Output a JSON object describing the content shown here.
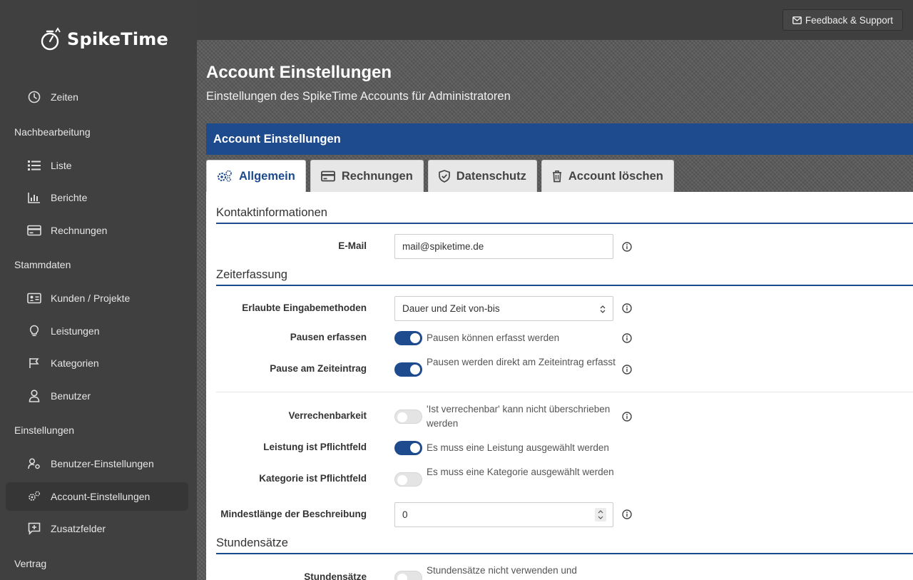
{
  "app": {
    "name": "SpikeTime"
  },
  "topbar": {
    "feedback_label": "Feedback & Support"
  },
  "sidebar": {
    "items": [
      {
        "label": "Zeiten",
        "icon": "clock-icon"
      },
      {
        "heading": "Nachbearbeitung"
      },
      {
        "label": "Liste",
        "icon": "list-icon"
      },
      {
        "label": "Berichte",
        "icon": "chart-icon"
      },
      {
        "label": "Rechnungen",
        "icon": "credit-card-icon"
      },
      {
        "heading": "Stammdaten"
      },
      {
        "label": "Kunden / Projekte",
        "icon": "address-card-icon"
      },
      {
        "label": "Leistungen",
        "icon": "lightbulb-icon"
      },
      {
        "label": "Kategorien",
        "icon": "flag-icon"
      },
      {
        "label": "Benutzer",
        "icon": "user-icon"
      },
      {
        "heading": "Einstellungen"
      },
      {
        "label": "Benutzer-Einstellungen",
        "icon": "user-cog-icon"
      },
      {
        "label": "Account-Einstellungen",
        "icon": "cogs-icon",
        "active": true
      },
      {
        "label": "Zusatzfelder",
        "icon": "comment-plus-icon"
      },
      {
        "heading": "Vertrag"
      }
    ]
  },
  "page": {
    "title": "Account Einstellungen",
    "subtitle": "Einstellungen des SpikeTime Accounts für Administratoren"
  },
  "card": {
    "title": "Account Einstellungen",
    "tabs": [
      {
        "label": "Allgemein",
        "icon": "cogs-icon",
        "active": true
      },
      {
        "label": "Rechnungen",
        "icon": "credit-card-icon"
      },
      {
        "label": "Datenschutz",
        "icon": "shield-check-icon"
      },
      {
        "label": "Account löschen",
        "icon": "trash-icon"
      }
    ]
  },
  "form": {
    "kontakt": {
      "title": "Kontaktinformationen",
      "email_label": "E-Mail",
      "email_value": "mail@spiketime.de"
    },
    "zeiterfassung": {
      "title": "Zeiterfassung",
      "methods_label": "Erlaubte Eingabemethoden",
      "methods_value": "Dauer und Zeit von-bis",
      "pausen_label": "Pausen erfassen",
      "pausen_desc": "Pausen können erfasst werden",
      "pausen_on": true,
      "pause_eintrag_label": "Pause am Zeiteintrag",
      "pause_eintrag_desc": "Pausen werden direkt am Zeiteintrag erfasst",
      "pause_eintrag_on": true,
      "verrechen_label": "Verrechenbarkeit",
      "verrechen_desc": "'Ist verrechenbar' kann nicht überschrieben werden",
      "verrechen_on": false,
      "leistung_label": "Leistung ist Pflichtfeld",
      "leistung_desc": "Es muss eine Leistung ausgewählt werden",
      "leistung_on": true,
      "kategorie_label": "Kategorie ist Pflichtfeld",
      "kategorie_desc": "Es muss eine Kategorie ausgewählt werden",
      "kategorie_on": false,
      "mindest_label": "Mindestlänge der Beschreibung",
      "mindest_value": "0"
    },
    "stundensaetze": {
      "title": "Stundensätze",
      "label": "Stundensätze",
      "desc": "Stundensätze nicht verwenden und",
      "on": false
    }
  },
  "colors": {
    "primary": "#1e4a8e",
    "sidebar": "#404040",
    "active_item": "#363636"
  }
}
